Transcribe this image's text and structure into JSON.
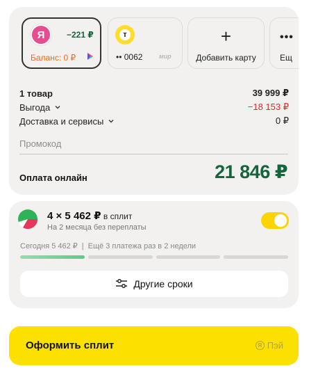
{
  "payment_methods": [
    {
      "logo_letter": "Я",
      "amount": "−221 ₽",
      "balance": "Баланс: 0 ₽",
      "selected": true
    },
    {
      "logo_letter": "т",
      "card_number": "•• 0062",
      "network": "мир"
    },
    {
      "icon": "plus-icon",
      "label": "Добавить карту"
    },
    {
      "icon": "more-dots-icon",
      "label": "Ещ"
    }
  ],
  "summary": {
    "items_label": "1 товар",
    "items_value": "39 999 ₽",
    "discount_label": "Выгода",
    "discount_value": "−18 153 ₽",
    "delivery_label": "Доставка и сервисы",
    "delivery_value": "0 ₽",
    "promo_placeholder": "Промокод",
    "pay_label": "Оплата онлайн",
    "pay_total": "21 846 ₽"
  },
  "split": {
    "title_main": "4 × 5 462 ₽",
    "title_rest": " в сплит",
    "subtitle": "На 2 месяца без переплаты",
    "toggle_on": true,
    "today": "Сегодня 5 462 ₽",
    "remaining": "Ещё 3 платежа раз в 2 недели",
    "segments_total": 4,
    "segments_paid": 1,
    "other_terms_label": "Другие сроки"
  },
  "cta": {
    "label": "Оформить сплит",
    "brand": "Пэй",
    "brand_mark": "Я"
  },
  "colors": {
    "accent_yellow": "#fce000",
    "green_total": "#13653a",
    "red_discount": "#d92b2b",
    "orange_balance": "#f06a1b",
    "card_bg": "#f2f1ef"
  }
}
